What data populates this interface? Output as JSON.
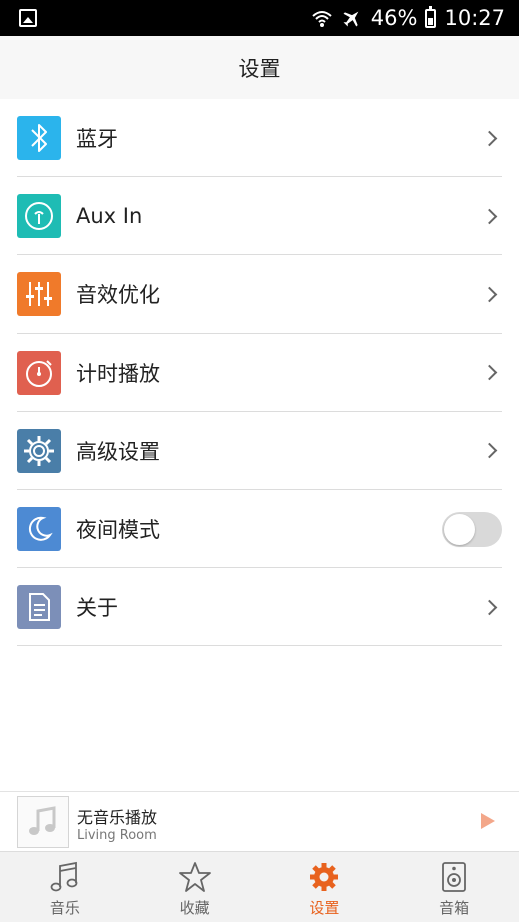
{
  "status_bar": {
    "battery": "46%",
    "time": "10:27",
    "icons": [
      "gallery-icon",
      "wifi-icon",
      "airplane-icon",
      "battery-icon"
    ]
  },
  "header": {
    "title": "设置"
  },
  "settings": {
    "items": [
      {
        "label": "蓝牙",
        "icon": "bluetooth-icon",
        "color": "#2bb4ec",
        "control": "chevron"
      },
      {
        "label": "Aux In",
        "icon": "headphone-jack-icon",
        "color": "#1ebcb4",
        "control": "chevron"
      },
      {
        "label": "音效优化",
        "icon": "equalizer-icon",
        "color": "#f07a2a",
        "control": "chevron"
      },
      {
        "label": "计时播放",
        "icon": "timer-icon",
        "color": "#e0604f",
        "control": "chevron"
      },
      {
        "label": "高级设置",
        "icon": "gear-icon",
        "color": "#4a7ea8",
        "control": "chevron"
      },
      {
        "label": "夜间模式",
        "icon": "moon-icon",
        "color": "#4d8ad3",
        "control": "toggle",
        "toggle_on": false
      },
      {
        "label": "关于",
        "icon": "document-icon",
        "color": "#7c8fb8",
        "control": "chevron"
      }
    ]
  },
  "player": {
    "track": "无音乐播放",
    "room": "Living Room",
    "play_color": "#f3a78a"
  },
  "tabs": [
    {
      "label": "音乐",
      "icon": "music-note-icon",
      "active": false
    },
    {
      "label": "收藏",
      "icon": "star-icon",
      "active": false
    },
    {
      "label": "设置",
      "icon": "settings-gear-icon",
      "active": true
    },
    {
      "label": "音箱",
      "icon": "speaker-icon",
      "active": false
    }
  ],
  "accent_color": "#e8621e"
}
